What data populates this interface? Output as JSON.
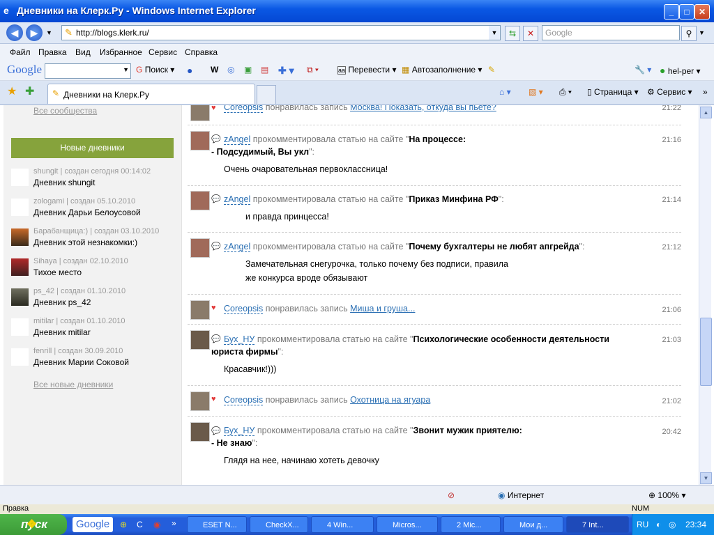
{
  "window": {
    "title": "Дневники на Клерк.Ру - Windows Internet Explorer"
  },
  "addressbar": {
    "url": "http://blogs.klerk.ru/",
    "search_placeholder": "Google"
  },
  "menu": [
    "Файл",
    "Правка",
    "Вид",
    "Избранное",
    "Сервис",
    "Справка"
  ],
  "google_toolbar": {
    "logo": "Google",
    "search_label": "Поиск",
    "translate": "Перевести",
    "autofill": "Автозаполнение",
    "user": "hel-per"
  },
  "tabs": {
    "active": "Дневники на Клерк.Ру",
    "page": "Страница",
    "service": "Сервис"
  },
  "sidebar": {
    "all_communities": "Все сообщества",
    "new_diaries_header": "Новые дневники",
    "diaries": [
      {
        "meta": "shungit | создан сегодня 00:14:02",
        "name": "Дневник shungit"
      },
      {
        "meta": "zologami | создан 05.10.2010",
        "name": "Дневник Дарьи Белоусовой"
      },
      {
        "meta": "Барабанщица:) | создан 03.10.2010",
        "name": "Дневник этой незнакомки:)"
      },
      {
        "meta": "Sihaya | создан 02.10.2010",
        "name": "Тихое место"
      },
      {
        "meta": "ps_42 | создан 01.10.2010",
        "name": "Дневник ps_42"
      },
      {
        "meta": "mitilar | создан 01.10.2010",
        "name": "Дневник mitilar"
      },
      {
        "meta": "fenrill | создан 30.09.2010",
        "name": "Дневник Марии Соковой"
      }
    ],
    "all_new": "Все новые дневники"
  },
  "feed": [
    {
      "user": "Coreopsis",
      "action": "понравилась запись",
      "link": "Москва! Показать, откуда вы пьете?",
      "time": "21:22"
    },
    {
      "user": "zAngel",
      "action": "прокомментировала статью на сайте",
      "title": "На процессе:",
      "title2": "- Подсудимый, Вы укл",
      "body": "Очень очаровательная первоклассница!",
      "time": "21:16"
    },
    {
      "user": "zAngel",
      "action": "прокомментировала статью на сайте",
      "title": "Приказ Минфина РФ",
      "body": "и правда принцесса!",
      "time": "21:14"
    },
    {
      "user": "zAngel",
      "action": "прокомментировала статью на сайте",
      "title": "Почему бухгалтеры не любят апгрейда",
      "body": "Замечательная снегурочка, только почему без подписи, правила",
      "body2": "же конкурса вроде обязывают",
      "time": "21:12"
    },
    {
      "user": "Coreopsis",
      "action": "понравилась запись",
      "link": "Миша и груша...",
      "time": "21:06"
    },
    {
      "user": "Бух_НУ",
      "action": "прокомментировала статью на сайте",
      "title": "Психологические особенности деятельности",
      "title2": "юриста фирмы",
      "body": "Красавчик!)))",
      "time": "21:03"
    },
    {
      "user": "Coreopsis",
      "action": "понравилась запись",
      "link": "Охотница на ягуара",
      "time": "21:02"
    },
    {
      "user": "Бух_НУ",
      "action": "прокомментировала статью на сайте",
      "title": "Звонит мужик приятелю:",
      "title2": "- Не знаю",
      "body": "Глядя на нее, начинаю хотеть девочку",
      "time": "20:42"
    }
  ],
  "status": {
    "zone": "Интернет",
    "zoom": "100%",
    "left": "Правка",
    "num": "NUM"
  },
  "taskbar": {
    "start": "пуск",
    "google": "Google",
    "items": [
      "ESET N...",
      "CheckX...",
      "4 Win...",
      "Micros...",
      "2 Mic...",
      "Мои д...",
      "7 Int..."
    ],
    "lang": "RU",
    "clock": "23:34"
  }
}
